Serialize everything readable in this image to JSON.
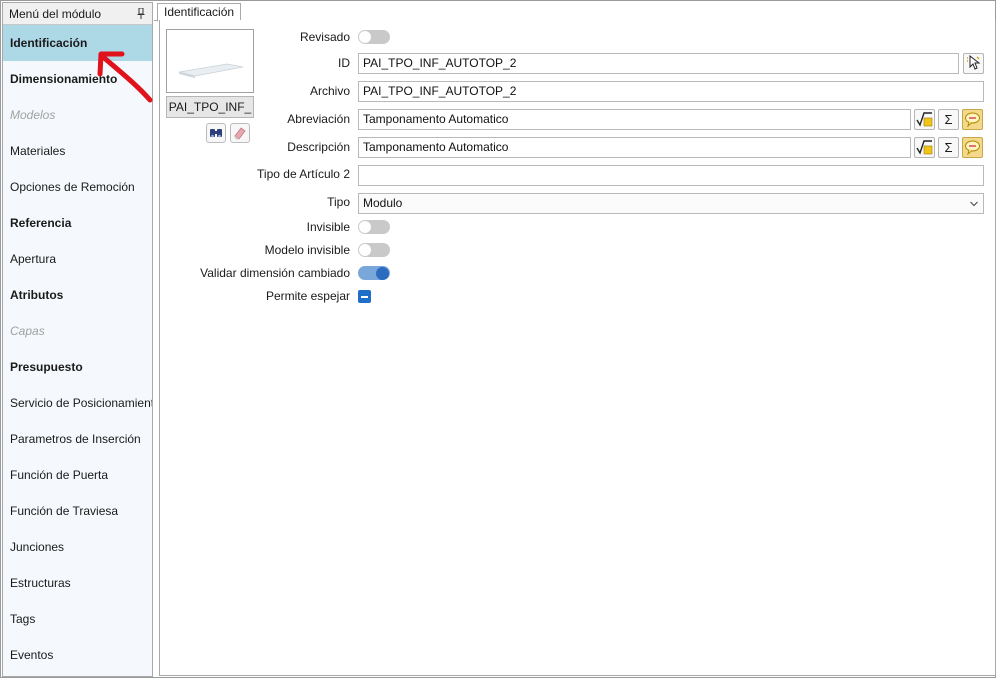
{
  "sidebar": {
    "title": "Menú del módulo",
    "items": [
      {
        "label": "Identificación",
        "style": "bold",
        "selected": true
      },
      {
        "label": "Dimensionamiento",
        "style": "bold"
      },
      {
        "label": "Modelos",
        "style": "disabled"
      },
      {
        "label": "Materiales",
        "style": "normal"
      },
      {
        "label": "Opciones de Remoción",
        "style": "normal"
      },
      {
        "label": "Referencia",
        "style": "bold"
      },
      {
        "label": "Apertura",
        "style": "normal"
      },
      {
        "label": "Atributos",
        "style": "bold"
      },
      {
        "label": "Capas",
        "style": "disabled"
      },
      {
        "label": "Presupuesto",
        "style": "bold"
      },
      {
        "label": "Servicio de Posicionamiento",
        "style": "normal"
      },
      {
        "label": "Parametros de Inserción",
        "style": "normal"
      },
      {
        "label": "Función de Puerta",
        "style": "normal"
      },
      {
        "label": "Función de Traviesa",
        "style": "normal"
      },
      {
        "label": "Junciones",
        "style": "normal"
      },
      {
        "label": "Estructuras",
        "style": "normal"
      },
      {
        "label": "Tags",
        "style": "normal"
      },
      {
        "label": "Eventos",
        "style": "normal"
      }
    ]
  },
  "tabs": [
    {
      "label": "Identificación"
    }
  ],
  "thumbnail": {
    "name": "PAI_TPO_INF_"
  },
  "form": {
    "revisado_label": "Revisado",
    "revisado": false,
    "id_label": "ID",
    "id_value": "PAI_TPO_INF_AUTOTOP_2",
    "archivo_label": "Archivo",
    "archivo_value": "PAI_TPO_INF_AUTOTOP_2",
    "abreviacion_label": "Abreviación",
    "abreviacion_value": "Tamponamento Automatico",
    "descripcion_label": "Descripción",
    "descripcion_value": "Tamponamento Automatico",
    "tipo_articulo_label": "Tipo de Artículo 2",
    "tipo_articulo_value": "",
    "tipo_label": "Tipo",
    "tipo_value": "Modulo",
    "invisible_label": "Invisible",
    "invisible": false,
    "modelo_invisible_label": "Modelo invisible",
    "modelo_invisible": false,
    "validar_label": "Validar dimensión cambiado",
    "validar": true,
    "permite_espejar_label": "Permite espejar",
    "permite_espejar": "indeterminate"
  },
  "icons": {
    "pin": "pin-icon",
    "binoculars": "binoculars-icon",
    "eraser": "eraser-icon",
    "formula": "formula-icon",
    "sigma": "sigma-icon",
    "translate": "translate-bubble-icon",
    "pick": "pick-cursor-icon",
    "chevron": "chevron-down-icon"
  },
  "colors": {
    "selected_item": "#add8e6",
    "toggle_on": "#2b6cbf",
    "annotation_arrow": "#e0121b"
  }
}
